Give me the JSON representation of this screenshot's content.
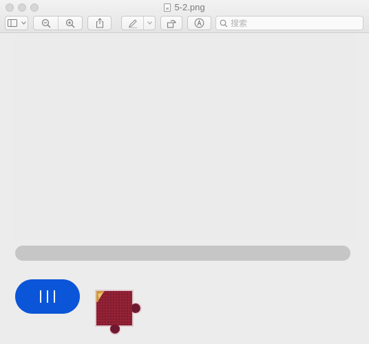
{
  "window": {
    "title": "5-2.png"
  },
  "toolbar": {
    "search_placeholder": "搜索",
    "icons": [
      "sidebar-icon",
      "chevron-down-icon",
      "zoom-out-icon",
      "zoom-in-icon",
      "share-icon",
      "markup-pen-icon",
      "rotate-icon",
      "annotate-icon",
      "search-icon"
    ]
  },
  "captcha": {
    "track_color": "#c6c6c6",
    "handle_color": "#0b55d8",
    "handle_grip": "|||",
    "slider_progress": 0
  }
}
